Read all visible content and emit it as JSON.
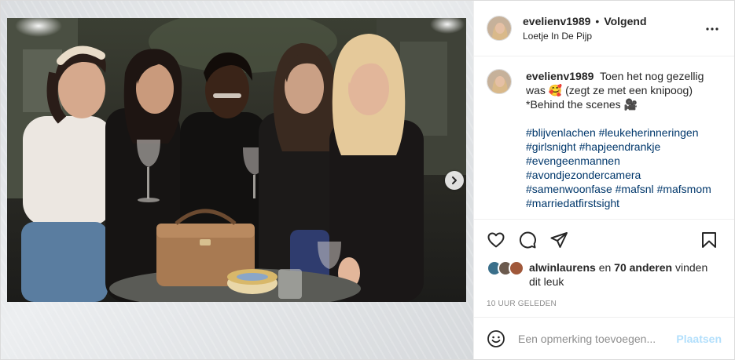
{
  "post": {
    "username": "evelienv1989",
    "separator": "•",
    "follow_state": "Volgend",
    "location": "Loetje In De Pijp",
    "caption": {
      "username": "evelienv1989",
      "text_1": "Toen het nog gezellig was",
      "emoji_1": "🥰",
      "text_2": "(zegt ze met een knipoog) *Behind the scenes",
      "emoji_2": "🎥",
      "hashtags": [
        "#blijvenlachen",
        "#leukeherinneringen",
        "#girlsnight",
        "#hapjeendrankje",
        "#evengeenmannen",
        "#avondjezondercamera",
        "#samenwoonfase",
        "#mafsnl",
        "#mafsmom",
        "#marriedatfirstsight"
      ]
    },
    "likes": {
      "first_user": "alwinlaurens",
      "connector": "en",
      "others": "70 anderen",
      "suffix": "vinden dit leuk"
    },
    "timestamp": "10 UUR GELEDEN",
    "comment_box": {
      "placeholder": "Een opmerking toevoegen...",
      "post_label": "Plaatsen"
    }
  },
  "icons": {
    "more": "more-horizontal-icon",
    "like": "heart-icon",
    "comment": "comment-bubble-icon",
    "share": "paper-plane-icon",
    "save": "bookmark-icon",
    "emoji": "smiley-icon",
    "next": "chevron-right-icon"
  },
  "colors": {
    "text": "#262626",
    "hashtag": "#00376b",
    "muted": "#8e8e8e",
    "post_disabled": "#b2dffc",
    "border": "#efefef"
  }
}
